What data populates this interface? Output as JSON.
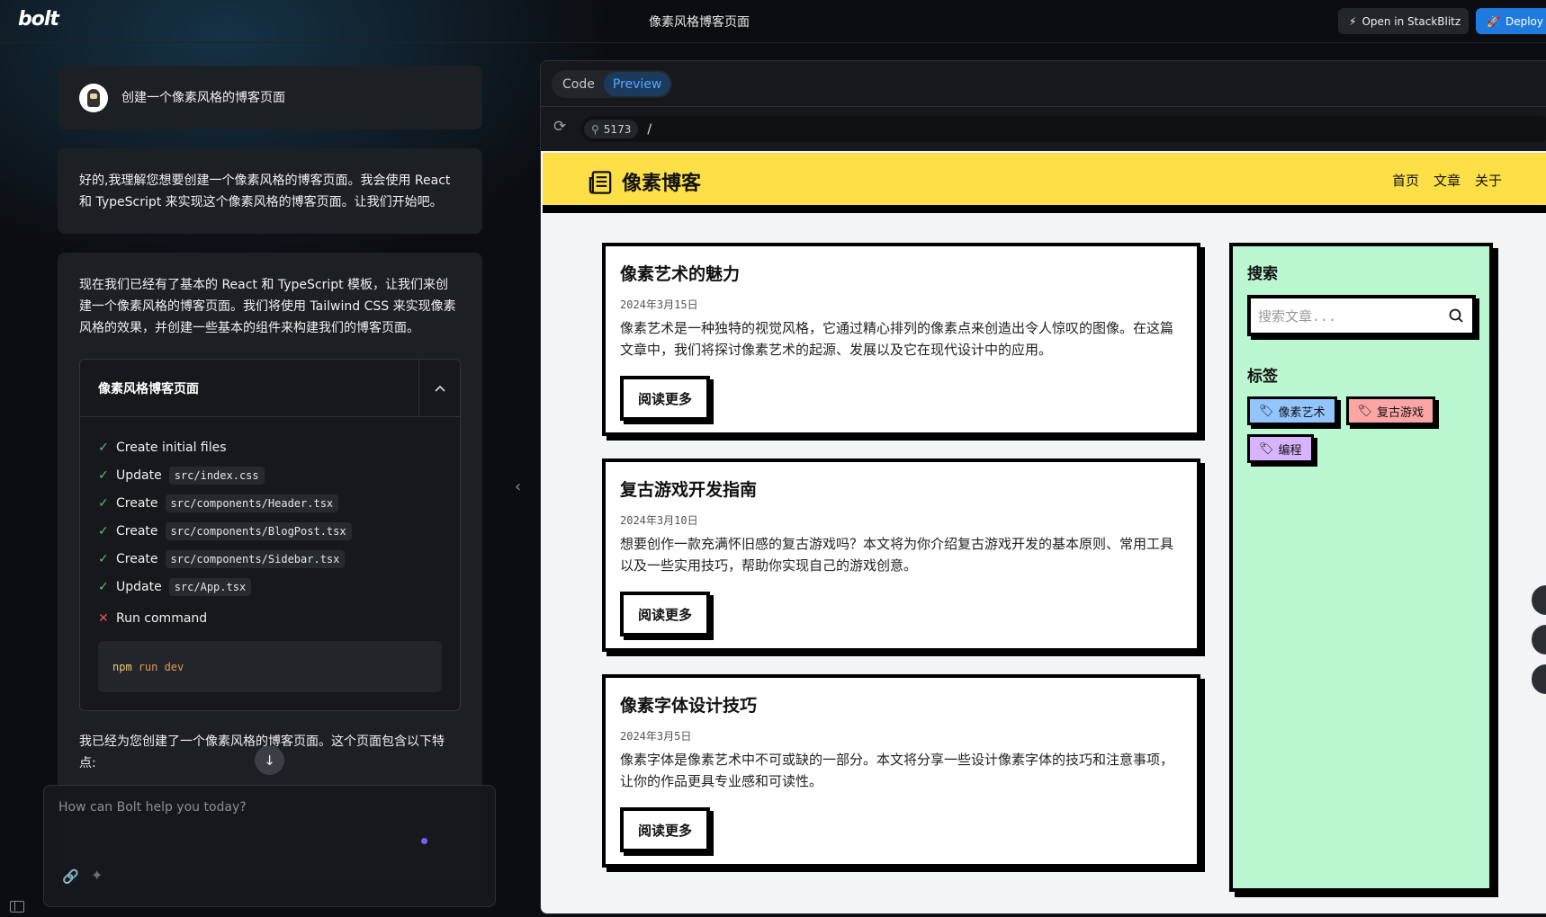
{
  "app": {
    "logo_text": "bolt",
    "title": "像素风格博客页面"
  },
  "toolbar": {
    "stackblitz_label": "Open in StackBlitz",
    "deploy_label": "Deploy"
  },
  "chat": {
    "user_message": "创建一个像素风格的博客页面",
    "assistant_message_1": "好的,我理解您想要创建一个像素风格的博客页面。我会使用 React 和 TypeScript 来实现这个像素风格的博客页面。让我们开始吧。",
    "assistant_message_2": "现在我们已经有了基本的 React 和 TypeScript 模板，让我们来创建一个像素风格的博客页面。我们将使用 Tailwind CSS 来实现像素风格的效果，并创建一些基本的组件来构建我们的博客页面。",
    "artifact": {
      "title": "像素风格博客页面",
      "steps": [
        {
          "status": "done",
          "action": "Create initial files",
          "file": ""
        },
        {
          "status": "done",
          "action": "Update",
          "file": "src/index.css"
        },
        {
          "status": "done",
          "action": "Create",
          "file": "src/components/Header.tsx"
        },
        {
          "status": "done",
          "action": "Create",
          "file": "src/components/BlogPost.tsx"
        },
        {
          "status": "done",
          "action": "Create",
          "file": "src/components/Sidebar.tsx"
        },
        {
          "status": "done",
          "action": "Update",
          "file": "src/App.tsx"
        },
        {
          "status": "failed",
          "action": "Run command",
          "file": ""
        }
      ],
      "command_npm": "npm",
      "command_rest": "run dev"
    },
    "final_message": "我已经为您创建了一个像素风格的博客页面。这个页面包含以下特点:",
    "input_placeholder": "How can Bolt help you today?"
  },
  "workbench": {
    "tabs": [
      {
        "label": "Code",
        "active": false
      },
      {
        "label": "Preview",
        "active": true
      }
    ],
    "port": "5173",
    "path": "/"
  },
  "site": {
    "name": "像素博客",
    "nav": [
      "首页",
      "文章",
      "关于"
    ],
    "posts": [
      {
        "title": "像素艺术的魅力",
        "date": "2024年3月15日",
        "excerpt": "像素艺术是一种独特的视觉风格，它通过精心排列的像素点来创造出令人惊叹的图像。在这篇文章中，我们将探讨像素艺术的起源、发展以及它在现代设计中的应用。",
        "button": "阅读更多"
      },
      {
        "title": "复古游戏开发指南",
        "date": "2024年3月10日",
        "excerpt": "想要创作一款充满怀旧感的复古游戏吗？本文将为你介绍复古游戏开发的基本原则、常用工具以及一些实用技巧，帮助你实现自己的游戏创意。",
        "button": "阅读更多"
      },
      {
        "title": "像素字体设计技巧",
        "date": "2024年3月5日",
        "excerpt": "像素字体是像素艺术中不可或缺的一部分。本文将分享一些设计像素字体的技巧和注意事项，让你的作品更具专业感和可读性。",
        "button": "阅读更多"
      }
    ],
    "sidebar": {
      "search_title": "搜索",
      "search_placeholder": "搜索文章...",
      "tags_title": "标签",
      "tags": [
        {
          "label": "像素艺术",
          "color": "#93c5fd"
        },
        {
          "label": "复古游戏",
          "color": "#fca5a5"
        },
        {
          "label": "编程",
          "color": "#d8b4fe"
        }
      ]
    }
  },
  "colors": {
    "header_bg": "#fde047",
    "sidebar_bg": "#bbf7d0",
    "accent_blue": "#1f7ae0",
    "preview_tab": "#58a6ff"
  }
}
